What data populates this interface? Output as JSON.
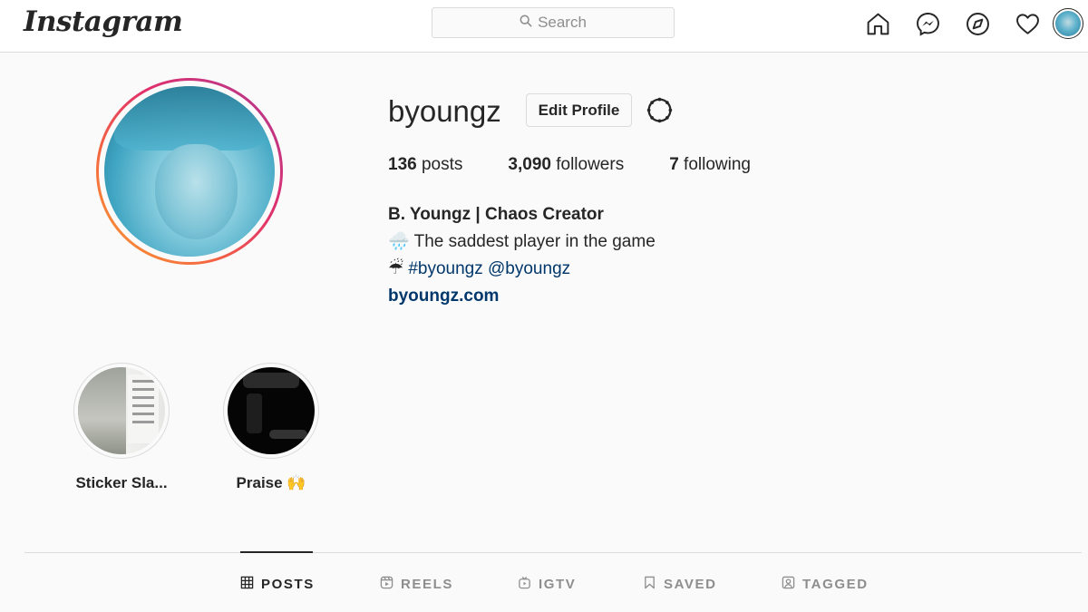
{
  "nav": {
    "logo": "Instagram",
    "search_placeholder": "Search",
    "icons": [
      "home-icon",
      "messenger-icon",
      "explore-icon",
      "heart-icon"
    ]
  },
  "profile": {
    "username": "byoungz",
    "edit_label": "Edit Profile",
    "stats": {
      "posts_count": "136",
      "posts_label": " posts",
      "followers_count": "3,090",
      "followers_label": " followers",
      "following_count": "7",
      "following_label": " following"
    },
    "bio": {
      "name": "B. Youngz | Chaos Creator",
      "line1_emoji": "🌧️",
      "line1_text": " The saddest player in the game",
      "line2_emoji": "☔",
      "hashtag": "#byoungz",
      "mention": "@byoungz",
      "url": "byoungz.com"
    }
  },
  "highlights": [
    {
      "label": "Sticker Sla..."
    },
    {
      "label": "Praise 🙌"
    }
  ],
  "tabs": [
    {
      "label": "POSTS",
      "active": true
    },
    {
      "label": "REELS",
      "active": false
    },
    {
      "label": "IGTV",
      "active": false
    },
    {
      "label": "SAVED",
      "active": false
    },
    {
      "label": "TAGGED",
      "active": false
    }
  ],
  "colors": {
    "link": "#00376b",
    "text": "#262626",
    "muted": "#8e8e8e",
    "border": "#dbdbdb",
    "background": "#fafafa"
  }
}
